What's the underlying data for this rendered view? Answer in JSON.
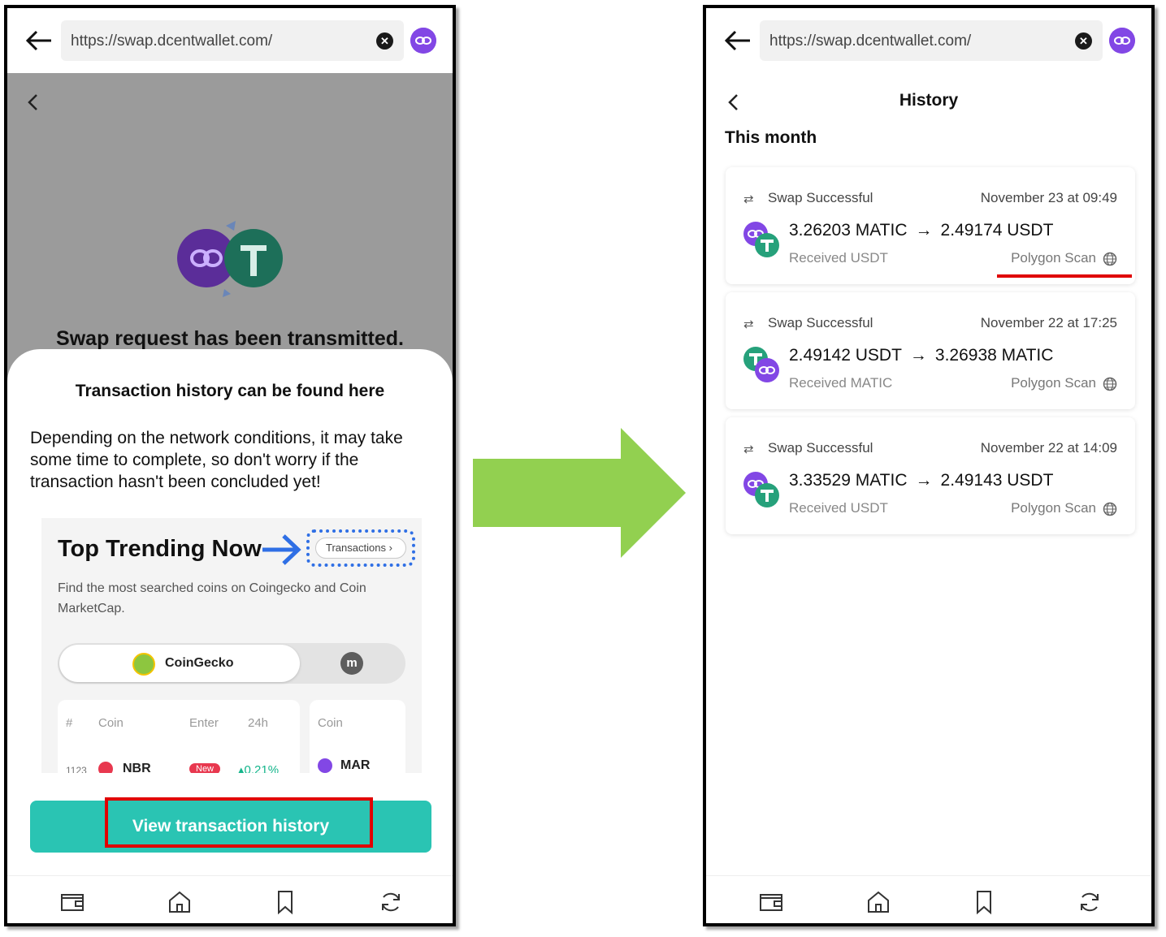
{
  "left_screen": {
    "url": "https://swap.dcentwallet.com/",
    "swap_message": "Swap request has been transmitted.",
    "sheet": {
      "title": "Transaction history can be found here",
      "description": "Depending on the network conditions, it may take some time to complete, so don't worry if the transaction hasn't been concluded yet!",
      "promo": {
        "title": "Top Trending Now",
        "transactions_label": "Transactions",
        "subtitle": "Find the most searched coins on Coingecko and Coin MarketCap.",
        "toggle_active": "CoinGecko",
        "table_headers": [
          "#",
          "Coin",
          "Enter",
          "24h"
        ],
        "row": {
          "rank": "1123",
          "coin": "NBR",
          "badge": "New",
          "change": "0.21%"
        },
        "table2_header": "Coin",
        "table2_coin": "MAR"
      },
      "button_label": "View transaction history"
    }
  },
  "right_screen": {
    "url": "https://swap.dcentwallet.com/",
    "title": "History",
    "section": "This month",
    "transactions": [
      {
        "status": "Swap Successful",
        "date": "November 23 at 09:49",
        "from": "3.26203 MATIC",
        "to": "2.49174 USDT",
        "received": "Received USDT",
        "scan": "Polygon Scan"
      },
      {
        "status": "Swap Successful",
        "date": "November 22 at 17:25",
        "from": "2.49142 USDT",
        "to": "3.26938 MATIC",
        "received": "Received MATIC",
        "scan": "Polygon Scan"
      },
      {
        "status": "Swap Successful",
        "date": "November 22 at 14:09",
        "from": "3.33529 MATIC",
        "to": "2.49143 USDT",
        "received": "Received USDT",
        "scan": "Polygon Scan"
      }
    ]
  },
  "colors": {
    "accent": "#2ac4b3",
    "polygon": "#8247e5",
    "tether": "#26a17b",
    "highlight": "#e00000",
    "arrow": "#92d050"
  },
  "icons": [
    "back-arrow-icon",
    "clear-icon",
    "polygon-icon",
    "chevron-left-icon",
    "swap-icon",
    "globe-icon",
    "wallet-icon",
    "home-icon",
    "bookmark-icon",
    "refresh-icon"
  ]
}
